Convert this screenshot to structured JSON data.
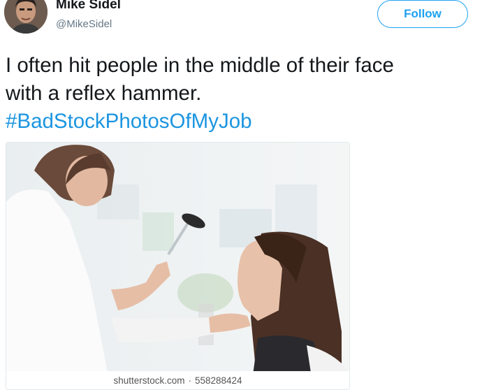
{
  "tweet": {
    "author": {
      "display_name": "Mike Sidel",
      "handle": "@MikeSidel",
      "avatar_icon": "avatar-photo"
    },
    "follow_label": "Follow",
    "text_lines": [
      "I often hit people in the middle of their face",
      "with a reflex hammer."
    ],
    "hashtag": "#BadStockPhotosOfMyJob",
    "media": {
      "watermark_site": "shutterstock.com",
      "watermark_separator": "·",
      "watermark_id": "558288424"
    }
  },
  "colors": {
    "accent": "#1da1f2",
    "hashtag": "#1b95e0",
    "text": "#14171a",
    "secondary": "#657786"
  }
}
